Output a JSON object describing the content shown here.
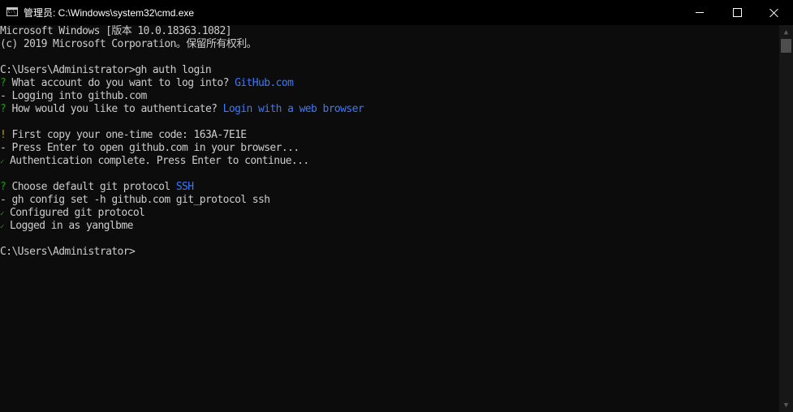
{
  "window": {
    "title": "管理员: C:\\Windows\\system32\\cmd.exe",
    "icon": "cmd-icon",
    "icon_text": "C:\\_",
    "controls": {
      "minimize": "minimize-icon",
      "maximize": "maximize-icon",
      "close": "close-icon"
    }
  },
  "colors": {
    "background": "#0c0c0c",
    "foreground": "#cccccc",
    "prompt_marker": "#13a10e",
    "warning_marker": "#c19c00",
    "highlight": "#3b78ff"
  },
  "console": {
    "lines": [
      {
        "marker": "",
        "text": "Microsoft Windows [版本 10.0.18363.1082]",
        "answer": ""
      },
      {
        "marker": "",
        "text": "(c) 2019 Microsoft Corporation。保留所有权利。",
        "answer": ""
      },
      {
        "marker": "",
        "text": "",
        "answer": ""
      },
      {
        "marker": "",
        "text": "C:\\Users\\Administrator>gh auth login",
        "answer": ""
      },
      {
        "marker": "?",
        "text": " What account do you want to log into? ",
        "answer": "GitHub.com"
      },
      {
        "marker": "-",
        "text": " Logging into github.com",
        "answer": ""
      },
      {
        "marker": "?",
        "text": " How would you like to authenticate? ",
        "answer": "Login with a web browser"
      },
      {
        "marker": "",
        "text": "",
        "answer": ""
      },
      {
        "marker": "!",
        "text": " First copy your one-time code: 163A-7E1E",
        "answer": ""
      },
      {
        "marker": "-",
        "text": " Press Enter to open github.com in your browser...",
        "answer": ""
      },
      {
        "marker": "✓",
        "text": " Authentication complete. Press Enter to continue...",
        "answer": ""
      },
      {
        "marker": "",
        "text": "",
        "answer": ""
      },
      {
        "marker": "?",
        "text": " Choose default git protocol ",
        "answer": "SSH"
      },
      {
        "marker": "-",
        "text": " gh config set -h github.com git_protocol ssh",
        "answer": ""
      },
      {
        "marker": "✓",
        "text": " Configured git protocol",
        "answer": ""
      },
      {
        "marker": "✓",
        "text": " Logged in as yanglbme",
        "answer": ""
      },
      {
        "marker": "",
        "text": "",
        "answer": ""
      },
      {
        "marker": "",
        "text": "C:\\Users\\Administrator>",
        "answer": ""
      }
    ]
  },
  "scrollbar": {
    "up_icon": "▲",
    "down_icon": "▼"
  }
}
